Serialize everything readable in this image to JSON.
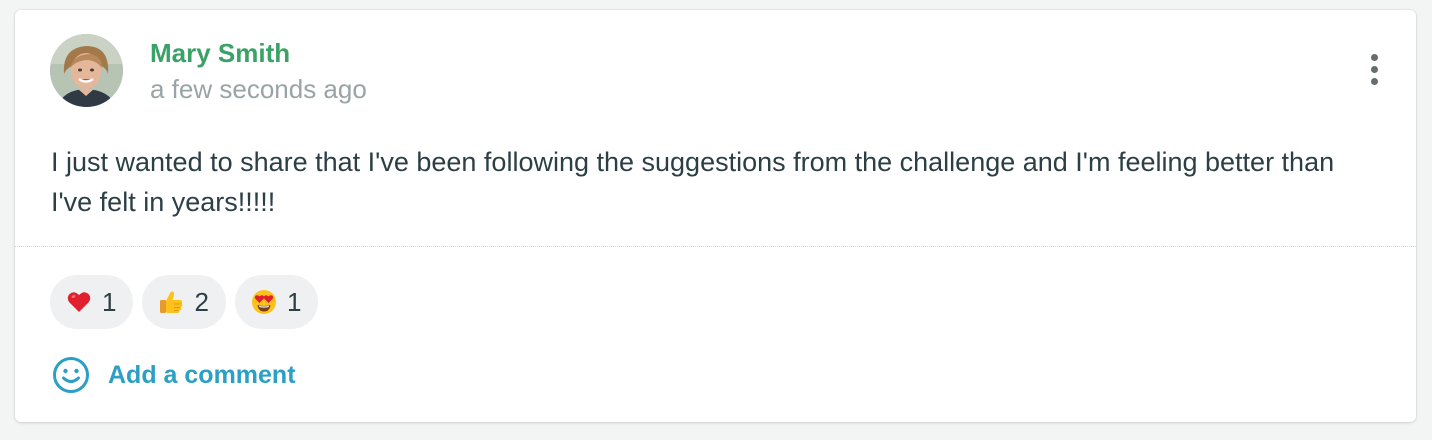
{
  "post": {
    "author": "Mary Smith",
    "timestamp": "a few seconds ago",
    "text": "I just wanted to share that I've been following the suggestions from the challenge and I'm feeling better than I've felt in years!!!!!",
    "menu_icon": "more-vertical-icon"
  },
  "reactions": [
    {
      "icon": "red-heart-icon",
      "count": "1"
    },
    {
      "icon": "thumbs-up-icon",
      "count": "2"
    },
    {
      "icon": "heart-eyes-icon",
      "count": "1"
    }
  ],
  "comment": {
    "icon": "smiley-icon",
    "label": "Add a comment"
  },
  "colors": {
    "author": "#3aa266",
    "link": "#2b9fc4",
    "text": "#2b3f45",
    "muted": "#9aa3a6"
  }
}
